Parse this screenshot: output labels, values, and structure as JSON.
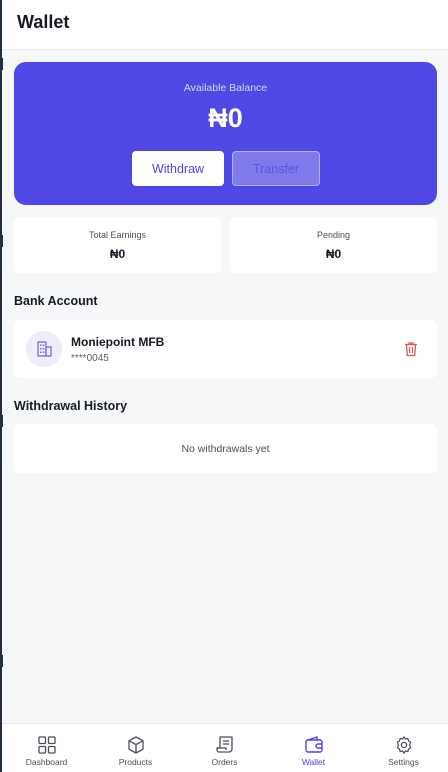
{
  "header": {
    "title": "Wallet"
  },
  "balance": {
    "label": "Available Balance",
    "amount": "₦0",
    "withdraw_label": "Withdraw",
    "transfer_label": "Transfer"
  },
  "stats": {
    "total_earnings_label": "Total Earnings",
    "total_earnings_value": "₦0",
    "pending_label": "Pending",
    "pending_value": "₦0"
  },
  "bank_account": {
    "section_title": "Bank Account",
    "bank_name": "Moniepoint MFB",
    "account_number": "****0045",
    "icon": "building-icon"
  },
  "withdrawal_history": {
    "section_title": "Withdrawal History",
    "empty_text": "No withdrawals yet"
  },
  "bottom_nav": {
    "items": [
      {
        "label": "Dashboard",
        "icon": "grid-icon",
        "active": false
      },
      {
        "label": "Products",
        "icon": "box-icon",
        "active": false
      },
      {
        "label": "Orders",
        "icon": "receipt-icon",
        "active": false
      },
      {
        "label": "Wallet",
        "icon": "wallet-icon",
        "active": true
      },
      {
        "label": "Settings",
        "icon": "gear-icon",
        "active": false
      }
    ]
  },
  "colors": {
    "accent": "#5048e5",
    "danger": "#e05252",
    "background": "#f6f7f9"
  }
}
